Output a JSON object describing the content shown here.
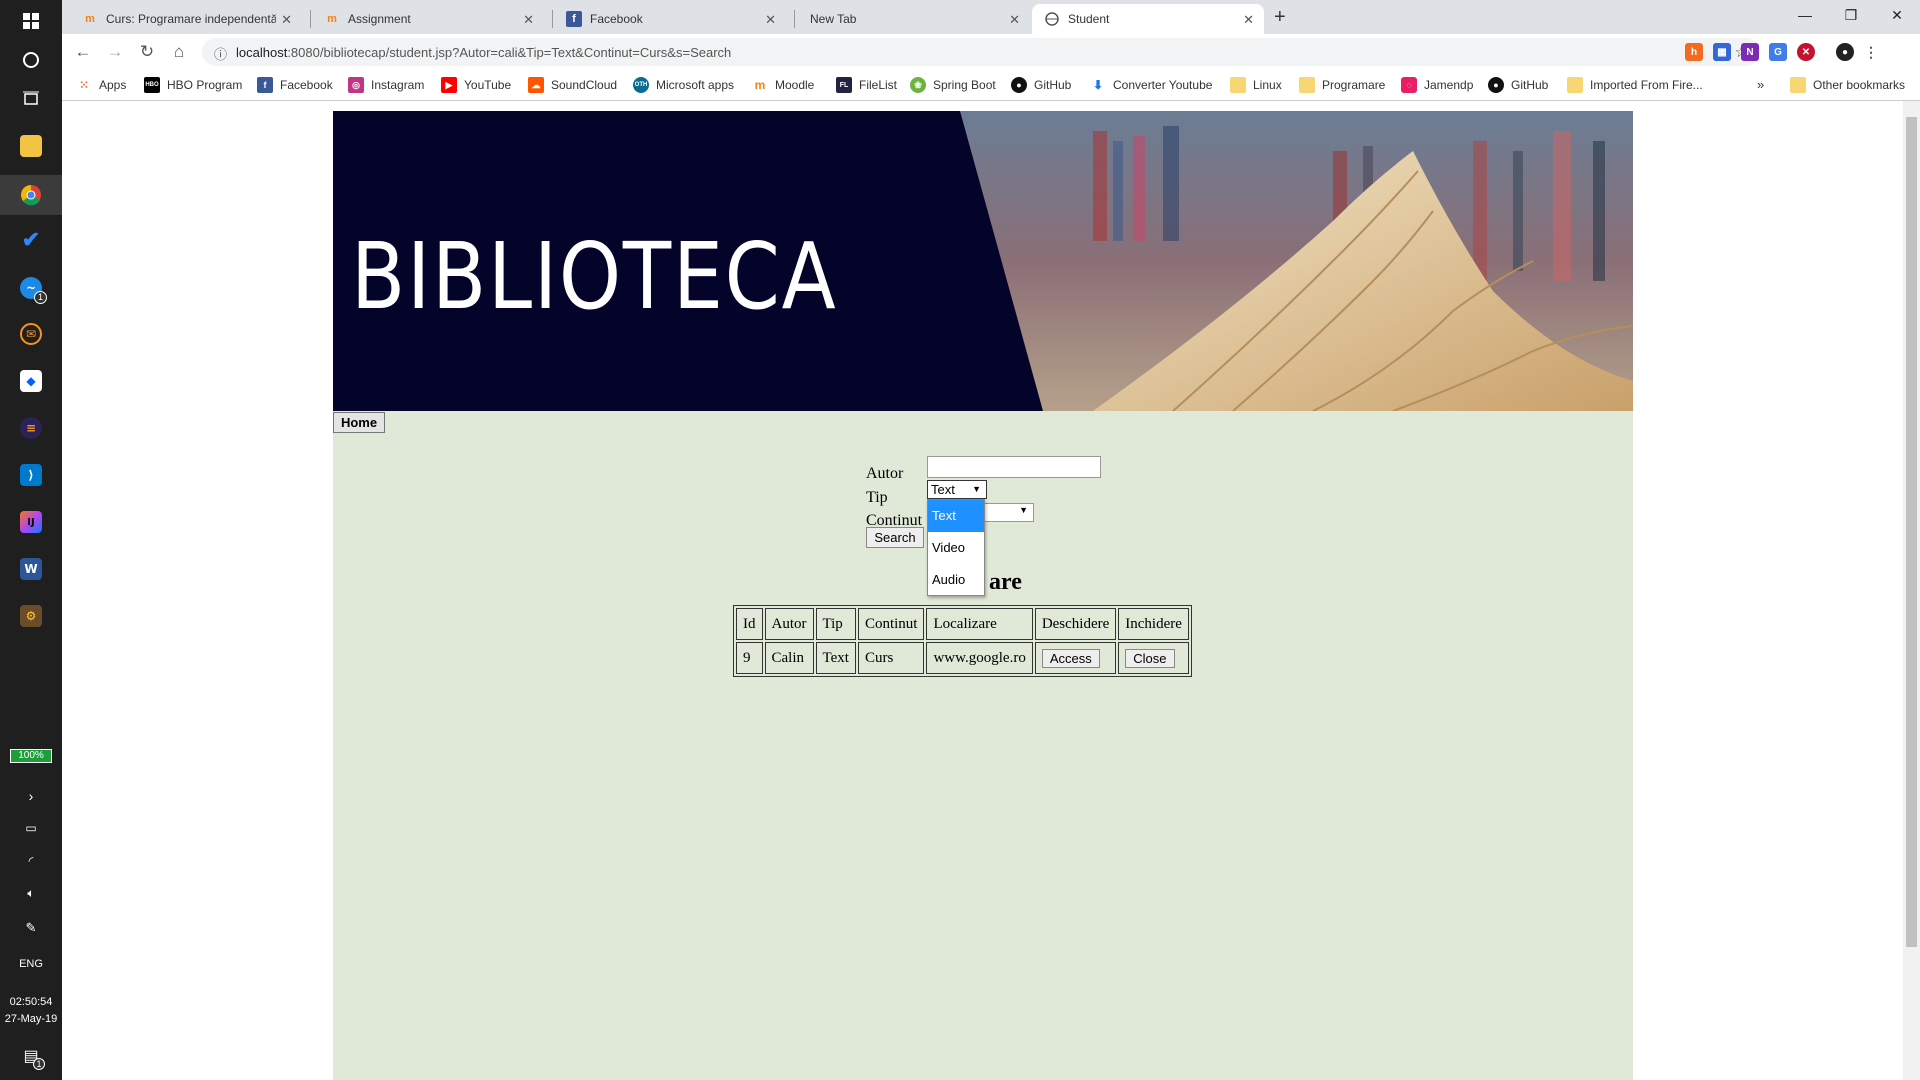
{
  "taskbar": {
    "battery": "100%",
    "language": "ENG",
    "time": "02:50:54",
    "date": "27-May-19",
    "messenger_badge": "1",
    "notif_badge": "1"
  },
  "browser": {
    "tabs": [
      {
        "title": "Curs: Programare independentă",
        "favicon": "moodle-icon"
      },
      {
        "title": "Assignment",
        "favicon": "moodle-icon"
      },
      {
        "title": "Facebook",
        "favicon": "facebook-icon"
      },
      {
        "title": "New Tab",
        "favicon": ""
      },
      {
        "title": "Student",
        "favicon": "globe-icon",
        "active": true
      }
    ],
    "url_host": "localhost",
    "url_rest": ":8080/bibliotecap/student.jsp?Autor=cali&Tip=Text&Continut=Curs&s=Search",
    "bookmarks": [
      "Apps",
      "HBO Program",
      "Facebook",
      "Instagram",
      "YouTube",
      "SoundCloud",
      "Microsoft apps",
      "Moodle",
      "FileList",
      "Spring Boot",
      "GitHub",
      "Converter Youtube",
      "Linux",
      "Programare",
      "Jamendp",
      "GitHub",
      "Imported From Fire..."
    ],
    "other_bookmarks": "Other bookmarks",
    "more": "»"
  },
  "page": {
    "banner_title": "BIBLIOTECA",
    "home_button": "Home",
    "form": {
      "autor_label": "Autor",
      "autor_value": "",
      "tip_label": "Tip",
      "tip_value": "Text",
      "continut_label": "Continut",
      "continut_value": "",
      "search_button": "Search"
    },
    "tip_options": [
      "Text",
      "Video",
      "Audio"
    ],
    "tip_selected_index": 0,
    "heading_visible": "are",
    "table": {
      "headers": [
        "Id",
        "Autor",
        "Tip",
        "Continut",
        "Localizare",
        "Deschidere",
        "Inchidere"
      ],
      "rows": [
        {
          "id": "9",
          "autor": "Calin",
          "tip": "Text",
          "continut": "Curs",
          "localizare": "www.google.ro",
          "deschidere": "Access",
          "inchidere": "Close"
        }
      ]
    }
  },
  "colors": {
    "page_bg": "#e0e8d8",
    "banner_bg": "#04042a",
    "dropdown_selected": "#1e90ff"
  }
}
